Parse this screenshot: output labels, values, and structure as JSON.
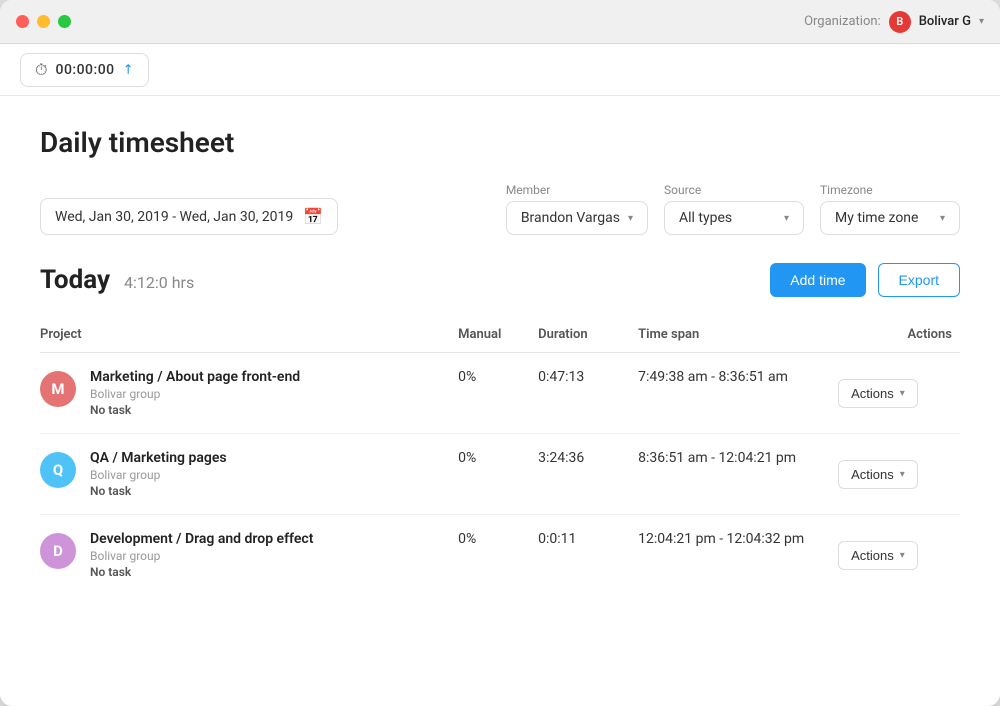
{
  "window": {
    "title": "Daily timesheet"
  },
  "titlebar": {
    "traffic_lights": [
      "close",
      "minimize",
      "maximize"
    ],
    "org_label": "Organization:",
    "org_avatar_letter": "B",
    "org_name": "Bolivar G",
    "chevron": "▾"
  },
  "timer": {
    "time": "00:00:00",
    "link_icon": "↗"
  },
  "page": {
    "title": "Daily timesheet"
  },
  "filters": {
    "date_range": "Wed, Jan 30, 2019 - Wed, Jan 30, 2019",
    "member_label": "Member",
    "member_value": "Brandon Vargas",
    "source_label": "Source",
    "source_value": "All types",
    "timezone_label": "Timezone",
    "timezone_value": "My time zone"
  },
  "today": {
    "label": "Today",
    "hours": "4:12:0 hrs",
    "add_time_btn": "Add time",
    "export_btn": "Export"
  },
  "table": {
    "columns": {
      "project": "Project",
      "manual": "Manual",
      "duration": "Duration",
      "timespan": "Time span",
      "actions": "Actions"
    },
    "rows": [
      {
        "avatar_letter": "M",
        "avatar_class": "avatar-m",
        "project_name": "Marketing / About page front-end",
        "group": "Bolivar group",
        "task": "No task",
        "manual": "0%",
        "duration": "0:47:13",
        "timespan": "7:49:38 am - 8:36:51 am",
        "actions_label": "Actions"
      },
      {
        "avatar_letter": "Q",
        "avatar_class": "avatar-q",
        "project_name": "QA / Marketing pages",
        "group": "Bolivar group",
        "task": "No task",
        "manual": "0%",
        "duration": "3:24:36",
        "timespan": "8:36:51 am - 12:04:21 pm",
        "actions_label": "Actions"
      },
      {
        "avatar_letter": "D",
        "avatar_class": "avatar-d",
        "project_name": "Development / Drag and drop effect",
        "group": "Bolivar group",
        "task": "No task",
        "manual": "0%",
        "duration": "0:0:11",
        "timespan": "12:04:21 pm - 12:04:32 pm",
        "actions_label": "Actions"
      }
    ]
  }
}
